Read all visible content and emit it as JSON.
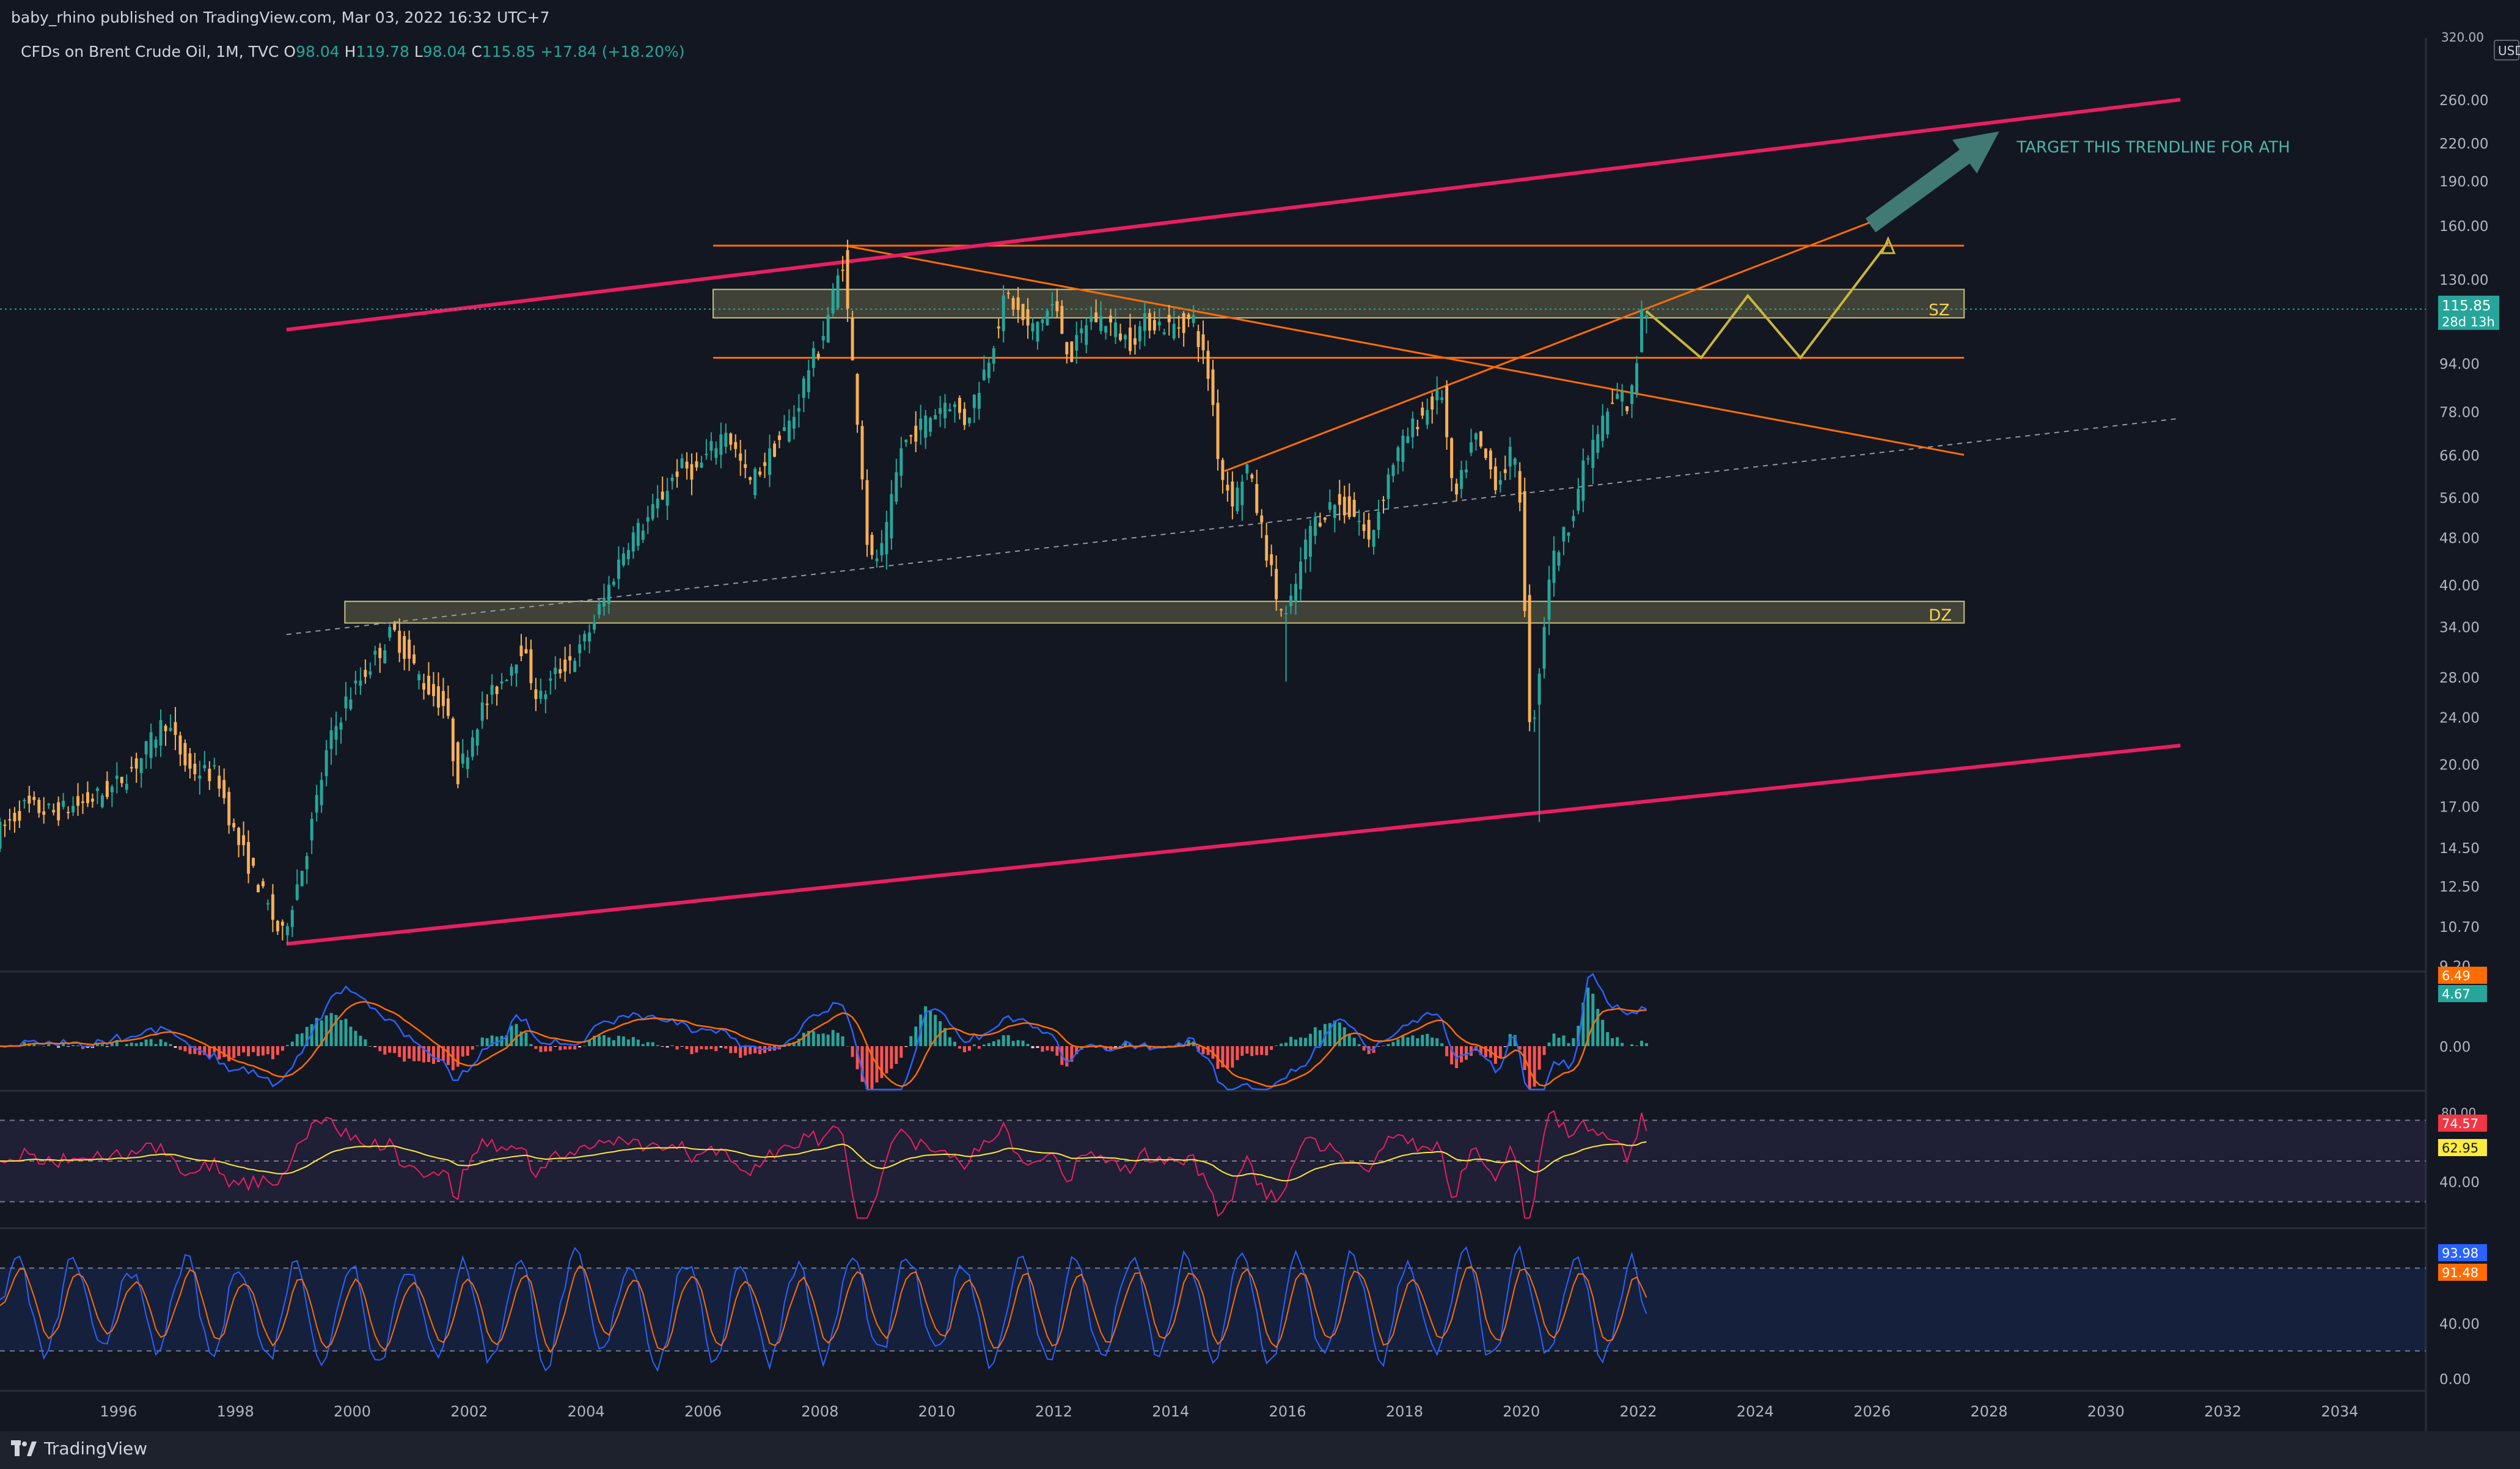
{
  "header": {
    "published": "baby_rhino published on TradingView.com, Mar 03, 2022 16:32 UTC+7",
    "symbol": "CFDs on Brent Crude Oil, 1M, TVC",
    "o_label": "O",
    "o_value": "98.04",
    "h_label": "H",
    "h_value": "119.78",
    "l_label": "L",
    "l_value": "98.04",
    "c_label": "C",
    "c_value": "115.85",
    "change": "+17.84 (+18.20%)"
  },
  "footer": {
    "brand": "TradingView"
  },
  "colors": {
    "background": "#131722",
    "up": "#26a69a",
    "down": "#f7b057",
    "channel": "#e91e63",
    "trend": "#ff6d00",
    "zone": "#c9c27a",
    "projection": "#c8b63a",
    "arrow": "#4a8c84",
    "macd": "#2962ff",
    "signal": "#ff6d00",
    "rsi": "#e91e63",
    "rsi_ma": "#ffeb3b"
  },
  "chart_data": [
    {
      "type": "candlestick",
      "name": "price",
      "y_scale": "log",
      "y_unit": "USD",
      "ylim": [
        9.2,
        320
      ],
      "ytick_labels": [
        "260.00",
        "220.00",
        "190.00",
        "160.00",
        "130.00",
        "115.85",
        "94.00",
        "78.00",
        "66.00",
        "56.00",
        "48.00",
        "40.00",
        "34.00",
        "28.00",
        "24.00",
        "20.00",
        "17.00",
        "14.50",
        "12.50",
        "10.70",
        "9.20"
      ],
      "xlim": [
        1994.0,
        2035.5
      ],
      "xtick_labels": [
        "1996",
        "1998",
        "2000",
        "2002",
        "2004",
        "2006",
        "2008",
        "2010",
        "2012",
        "2014",
        "2016",
        "2018",
        "2020",
        "2022",
        "2024",
        "2026",
        "2028",
        "2030",
        "2032",
        "2034"
      ],
      "last_price": "115.85",
      "countdown": "28d 13h",
      "anchor_points": [
        [
          1994.0,
          15.2
        ],
        [
          1994.5,
          17.0
        ],
        [
          1995.0,
          16.6
        ],
        [
          1995.5,
          17.2
        ],
        [
          1996.0,
          18.2
        ],
        [
          1996.5,
          20.5
        ],
        [
          1996.9,
          23.8
        ],
        [
          1997.3,
          19.6
        ],
        [
          1997.8,
          19.2
        ],
        [
          1998.1,
          15.2
        ],
        [
          1998.5,
          12.6
        ],
        [
          1998.9,
          10.2
        ],
        [
          1999.3,
          14.0
        ],
        [
          1999.7,
          21.5
        ],
        [
          2000.0,
          25.5
        ],
        [
          2000.5,
          30.2
        ],
        [
          2000.8,
          33.5
        ],
        [
          2001.3,
          27.5
        ],
        [
          2001.7,
          25.0
        ],
        [
          2001.9,
          19.0
        ],
        [
          2002.3,
          24.5
        ],
        [
          2002.7,
          28.0
        ],
        [
          2003.0,
          31.5
        ],
        [
          2003.3,
          25.5
        ],
        [
          2003.6,
          28.5
        ],
        [
          2004.0,
          31.0
        ],
        [
          2004.4,
          37.5
        ],
        [
          2004.8,
          47.0
        ],
        [
          2005.2,
          52.0
        ],
        [
          2005.7,
          63.0
        ],
        [
          2006.0,
          62.0
        ],
        [
          2006.5,
          73.0
        ],
        [
          2006.9,
          59.0
        ],
        [
          2007.3,
          67.0
        ],
        [
          2007.7,
          78.0
        ],
        [
          2007.9,
          92.0
        ],
        [
          2008.1,
          100.0
        ],
        [
          2008.5,
          140.0
        ],
        [
          2008.8,
          68.0
        ],
        [
          2008.95,
          43.0
        ],
        [
          2009.2,
          46.0
        ],
        [
          2009.5,
          68.0
        ],
        [
          2009.9,
          75.0
        ],
        [
          2010.3,
          82.0
        ],
        [
          2010.6,
          75.0
        ],
        [
          2010.95,
          93.0
        ],
        [
          2011.3,
          123.0
        ],
        [
          2011.7,
          106.0
        ],
        [
          2012.1,
          118.0
        ],
        [
          2012.4,
          96.0
        ],
        [
          2012.7,
          112.0
        ],
        [
          2013.0,
          111.0
        ],
        [
          2013.4,
          102.0
        ],
        [
          2013.7,
          111.0
        ],
        [
          2014.1,
          108.0
        ],
        [
          2014.5,
          111.0
        ],
        [
          2014.8,
          86.0
        ],
        [
          2014.95,
          62.0
        ],
        [
          2015.2,
          55.0
        ],
        [
          2015.4,
          64.0
        ],
        [
          2015.7,
          48.0
        ],
        [
          2015.95,
          37.0
        ],
        [
          2016.1,
          35.0
        ],
        [
          2016.5,
          50.0
        ],
        [
          2016.9,
          55.0
        ],
        [
          2017.3,
          52.0
        ],
        [
          2017.5,
          47.0
        ],
        [
          2017.9,
          64.0
        ],
        [
          2018.3,
          75.0
        ],
        [
          2018.75,
          84.0
        ],
        [
          2018.95,
          54.0
        ],
        [
          2019.3,
          71.0
        ],
        [
          2019.7,
          59.0
        ],
        [
          2019.95,
          67.0
        ],
        [
          2020.1,
          55.0
        ],
        [
          2020.25,
          23.0
        ],
        [
          2020.35,
          25.0
        ],
        [
          2020.6,
          43.0
        ],
        [
          2020.9,
          50.0
        ],
        [
          2021.2,
          64.0
        ],
        [
          2021.5,
          75.0
        ],
        [
          2021.8,
          84.0
        ],
        [
          2021.95,
          78.0
        ],
        [
          2022.1,
          98.0
        ],
        [
          2022.16,
          115.85
        ]
      ],
      "zones": [
        {
          "label": "SZ",
          "low": 112.0,
          "high": 125.0,
          "x_start": 2006.2,
          "x_end": 2027.6
        },
        {
          "label": "DZ",
          "low": 34.5,
          "high": 37.5,
          "x_start": 1999.9,
          "x_end": 2027.6
        }
      ],
      "channel_upper": [
        [
          1998.9,
          107.0
        ],
        [
          2031.3,
          260.0
        ]
      ],
      "channel_lower": [
        [
          1998.9,
          10.0
        ],
        [
          2031.3,
          21.5
        ]
      ],
      "midline_dashed": [
        [
          1998.9,
          33.0
        ],
        [
          2031.3,
          76.0
        ]
      ],
      "horizontal_levels": [
        {
          "price": 148.0,
          "x_start": 2006.2,
          "x_end": 2027.6
        },
        {
          "price": 96.0,
          "x_start": 2006.2,
          "x_end": 2027.6
        }
      ],
      "trend_lines": [
        [
          [
            2008.45,
            148.0
          ],
          [
            2027.6,
            66.0
          ]
        ],
        [
          [
            2014.95,
            62.0
          ],
          [
            2026.0,
            162.0
          ]
        ]
      ],
      "projection_path": [
        [
          2022.16,
          115.0
        ],
        [
          2023.1,
          96.0
        ],
        [
          2023.9,
          122.0
        ],
        [
          2024.8,
          96.0
        ],
        [
          2026.3,
          150.0
        ]
      ],
      "annotation": {
        "text": "TARGET THIS TRENDLINE FOR ATH",
        "arrow_from": [
          2026.0,
          160.0
        ],
        "arrow_to": [
          2028.2,
          230.0
        ]
      }
    },
    {
      "type": "histogram",
      "name": "MACD",
      "ytick_labels": [
        "0.00"
      ],
      "value_tags": [
        "6.49",
        "4.67"
      ]
    },
    {
      "type": "line",
      "name": "RSI",
      "ylim": [
        20,
        80
      ],
      "ytick_labels": [
        "40.00"
      ],
      "top_tick": "80.00",
      "bands": [
        70,
        50,
        30
      ],
      "value_tags": [
        "74.57",
        "62.95"
      ]
    },
    {
      "type": "line",
      "name": "Stoch RSI",
      "ylim": [
        0,
        100
      ],
      "ytick_labels": [
        "40.00",
        "0.00"
      ],
      "bands": [
        80,
        20
      ],
      "value_tags": [
        "93.98",
        "91.48"
      ]
    }
  ]
}
